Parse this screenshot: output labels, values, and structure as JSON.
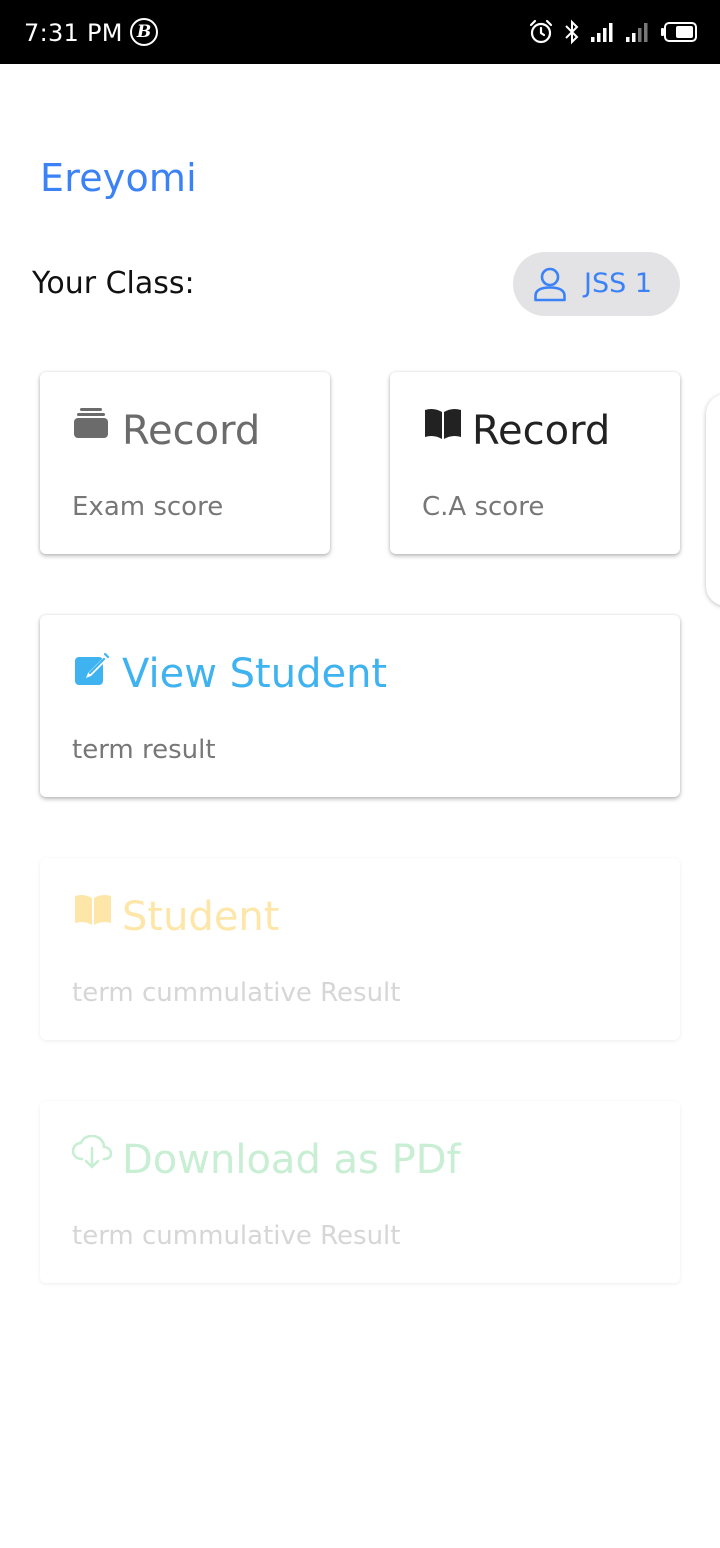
{
  "status_bar": {
    "time": "7:31 PM",
    "b_badge": "B"
  },
  "app": {
    "title": "Ereyomi"
  },
  "class_section": {
    "label": "Your Class:",
    "chip_label": "JSS 1",
    "chip_icon": "person-icon"
  },
  "cards": [
    {
      "title": "Record",
      "subtitle": "Exam score",
      "icon": "folder-icon",
      "color": "#6b6b6b"
    },
    {
      "title": "Record",
      "subtitle": "C.A score",
      "icon": "book-open-icon",
      "color": "#222222"
    },
    {
      "title": "View Student",
      "subtitle": "term result",
      "icon": "edit-icon",
      "color": "#3fb2f0"
    },
    {
      "title": "Student",
      "subtitle": "term cummulative Result",
      "icon": "book-open-icon",
      "color": "#fde6a8"
    },
    {
      "title": "Download as PDf",
      "subtitle": "term cummulative Result",
      "icon": "cloud-download-icon",
      "color": "#c8eed3"
    }
  ],
  "colors": {
    "accent": "#3b82f6",
    "chip_bg": "#e3e3e5"
  }
}
